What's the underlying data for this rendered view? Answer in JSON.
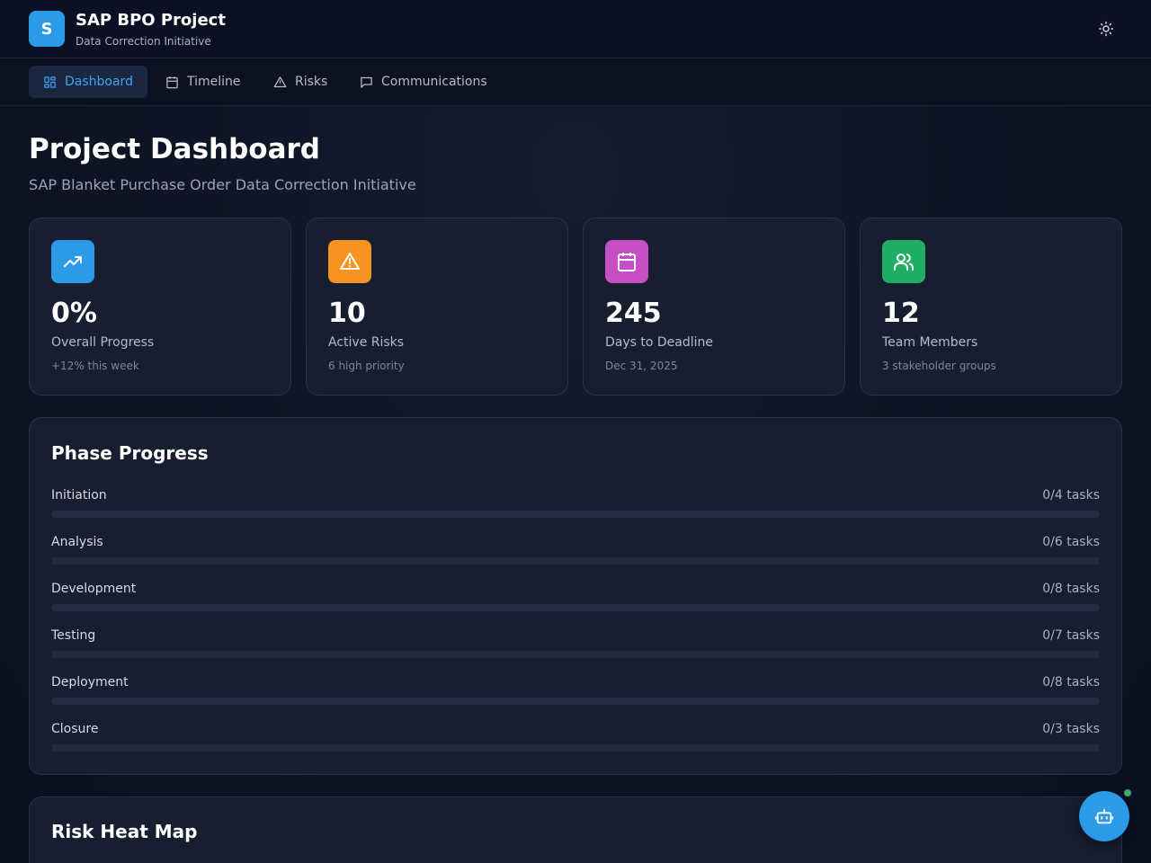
{
  "app": {
    "logo_letter": "S",
    "title": "SAP BPO Project",
    "subtitle": "Data Correction Initiative",
    "theme_icon": "sun-icon"
  },
  "nav": {
    "items": [
      {
        "label": "Dashboard",
        "icon": "dashboard-icon",
        "active": true
      },
      {
        "label": "Timeline",
        "icon": "calendar-icon",
        "active": false
      },
      {
        "label": "Risks",
        "icon": "warning-icon",
        "active": false
      },
      {
        "label": "Communications",
        "icon": "chat-icon",
        "active": false
      }
    ]
  },
  "page": {
    "title": "Project Dashboard",
    "subtitle": "SAP Blanket Purchase Order Data Correction Initiative"
  },
  "stats": [
    {
      "value": "0%",
      "label": "Overall Progress",
      "sub": "+12% this week",
      "icon": "trending-up-icon",
      "color": "#2b9be8"
    },
    {
      "value": "10",
      "label": "Active Risks",
      "sub": "6 high priority",
      "icon": "warning-icon",
      "color": "#f7931e"
    },
    {
      "value": "245",
      "label": "Days to Deadline",
      "sub": "Dec 31, 2025",
      "icon": "calendar-icon",
      "color": "#c74fc6"
    },
    {
      "value": "12",
      "label": "Team Members",
      "sub": "3 stakeholder groups",
      "icon": "users-icon",
      "color": "#1fae63"
    }
  ],
  "phase_progress": {
    "title": "Phase Progress",
    "phases": [
      {
        "name": "Initiation",
        "tasks": "0/4 tasks",
        "progress": 0
      },
      {
        "name": "Analysis",
        "tasks": "0/6 tasks",
        "progress": 0
      },
      {
        "name": "Development",
        "tasks": "0/8 tasks",
        "progress": 0
      },
      {
        "name": "Testing",
        "tasks": "0/7 tasks",
        "progress": 0
      },
      {
        "name": "Deployment",
        "tasks": "0/8 tasks",
        "progress": 0
      },
      {
        "name": "Closure",
        "tasks": "0/3 tasks",
        "progress": 0
      }
    ]
  },
  "risk_heat_map": {
    "title": "Risk Heat Map"
  },
  "assistant": {
    "icon": "bot-icon",
    "status_color": "#3fa86a"
  },
  "colors": {
    "accent": "#2b9be8",
    "background": "#0d1424",
    "card": "#161e30"
  }
}
